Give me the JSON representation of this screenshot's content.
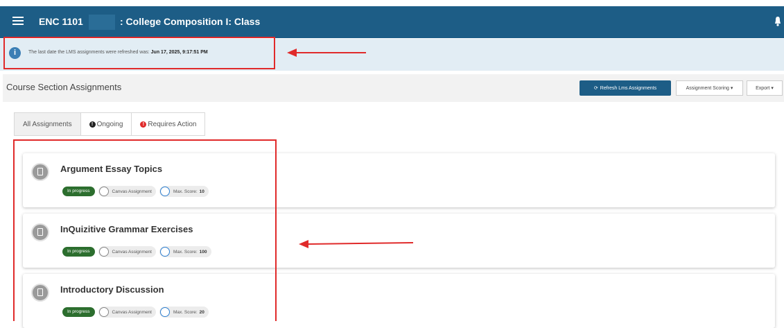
{
  "navbar": {
    "course_code": "ENC 1101",
    "course_title": ": College Composition I: Class",
    "menu_icon": "hamburger-menu-icon",
    "bell_icon": "bell-icon",
    "background": "#1d5d86"
  },
  "info": {
    "icon": "info-icon",
    "text": "The last date the LMS assignments were refreshed was:",
    "date": "Jun 17, 2025, 9:17:51 PM"
  },
  "section": {
    "title": "Course Section Assignments",
    "refresh_label": "Refresh Lms Assignments",
    "scoring_label": "Assignment Scoring ▾",
    "export_label": "Export ▾"
  },
  "tabs": [
    {
      "label": "All Assignments"
    },
    {
      "label": "Ongoing",
      "badge": "!",
      "badge_color": "#222222"
    },
    {
      "label": "Requires Action",
      "badge": "!",
      "badge_color": "#e02a2a"
    }
  ],
  "assignments": [
    {
      "title": "Argument Essay Topics",
      "status": "In progress",
      "type": "Canvas Assignment",
      "score_label": "Max. Score:",
      "score": "10"
    },
    {
      "title": "InQuizitive Grammar Exercises",
      "status": "In progress",
      "type": "Canvas Assignment",
      "score_label": "Max. Score:",
      "score": "100"
    },
    {
      "title": "Introductory Discussion",
      "status": "In progress",
      "type": "Canvas Assignment",
      "score_label": "Max. Score:",
      "score": "20"
    }
  ],
  "annotations": {
    "highlight_color": "#e02a2a"
  }
}
